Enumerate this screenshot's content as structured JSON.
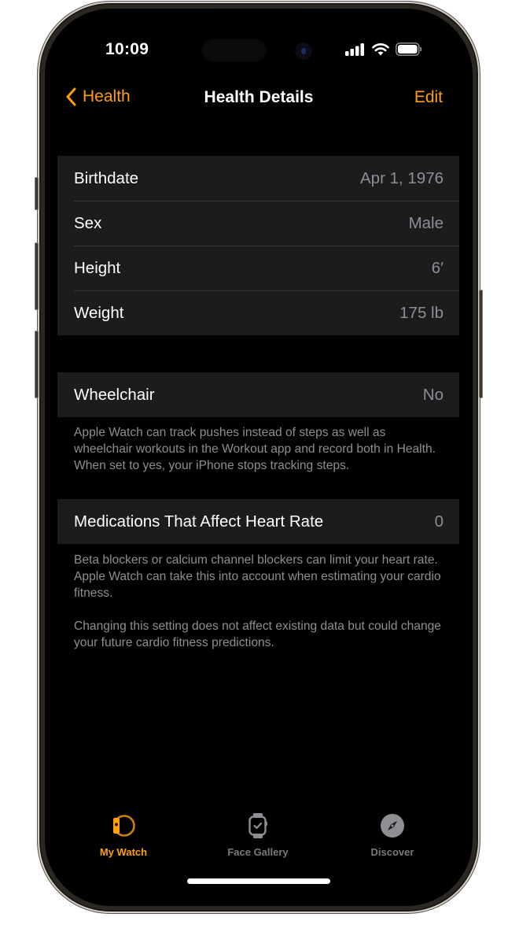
{
  "status_bar": {
    "time": "10:09",
    "icons": [
      "cellular-signal-icon",
      "wifi-icon",
      "battery-icon"
    ]
  },
  "nav": {
    "back_label": "Health",
    "back_icon": "chevron-left-icon",
    "title": "Health Details",
    "edit_label": "Edit"
  },
  "colors": {
    "accent": "#ff9f0a",
    "background": "#000000",
    "cell_background": "#1c1c1e",
    "secondary_text": "#8e8e93"
  },
  "details": [
    {
      "label": "Birthdate",
      "value": "Apr 1, 1976"
    },
    {
      "label": "Sex",
      "value": "Male"
    },
    {
      "label": "Height",
      "value": "6′"
    },
    {
      "label": "Weight",
      "value": "175 lb"
    }
  ],
  "wheelchair": {
    "label": "Wheelchair",
    "value": "No",
    "footnote": "Apple Watch can track pushes instead of steps as well as wheelchair workouts in the Workout app and record both in Health. When set to yes, your iPhone stops tracking steps."
  },
  "medications": {
    "label": "Medications That Affect Heart Rate",
    "value": "0",
    "footnote_1": "Beta blockers or calcium channel blockers can limit your heart rate. Apple Watch can take this into account when estimating your cardio fitness.",
    "footnote_2": "Changing this setting does not affect existing data but could change your future cardio fitness predictions."
  },
  "tabbar": {
    "tabs": [
      {
        "label": "My Watch",
        "icon": "my-watch-icon",
        "active": true
      },
      {
        "label": "Face Gallery",
        "icon": "face-gallery-icon",
        "active": false
      },
      {
        "label": "Discover",
        "icon": "compass-icon",
        "active": false
      }
    ]
  }
}
